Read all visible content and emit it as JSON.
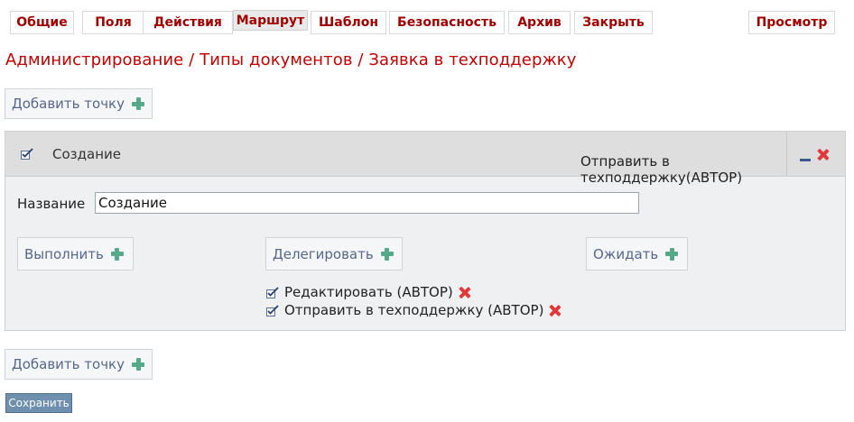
{
  "tabs": [
    {
      "label": "Общие",
      "active": false
    },
    {
      "label": "Поля",
      "active": false
    },
    {
      "label": "Действия",
      "active": false
    },
    {
      "label": "Маршрут",
      "active": true
    },
    {
      "label": "Шаблон",
      "active": false
    },
    {
      "label": "Безопасность",
      "active": false
    },
    {
      "label": "Архив",
      "active": false
    },
    {
      "label": "Закрыть",
      "active": false
    }
  ],
  "preview_tab": {
    "label": "Просмотр"
  },
  "breadcrumb": "Администрирование / Типы документов / Заявка в техподдержку",
  "add_point_label": "Добавить точку",
  "step": {
    "title": "Создание",
    "name_label": "Название",
    "name_value": "Создание",
    "execute_label": "Выполнить",
    "delegate_label": "Делегировать",
    "wait_label": "Ожидать",
    "delegate_actions": [
      "Редактировать (АВТОР)",
      "Отправить в техподдержку (АВТОР)"
    ],
    "wait_text": "Отправить в техподдержку(АВТОР)"
  },
  "save_label": "Сохранить",
  "colors": {
    "tab_text": "#a00000",
    "breadcrumb": "#c00000",
    "plus_icon": "#55a888",
    "delete_icon": "#e0383b",
    "save_button": "#6f8fae"
  }
}
